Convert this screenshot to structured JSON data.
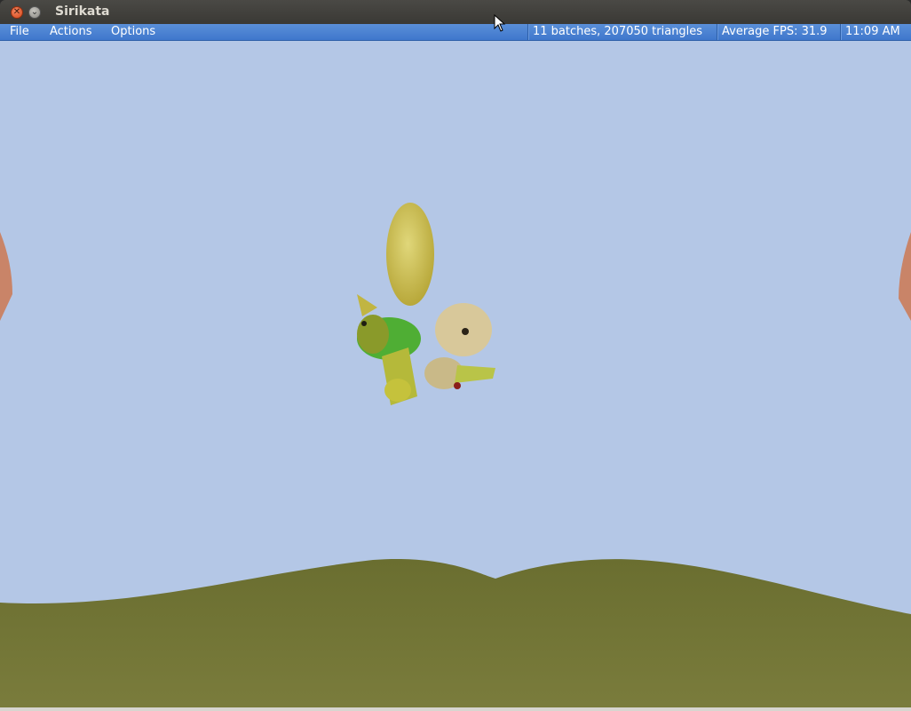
{
  "window": {
    "title": "Sirikata"
  },
  "menu": {
    "items": [
      "File",
      "Actions",
      "Options"
    ]
  },
  "status": {
    "batches": "11 batches, 207050 triangles",
    "fps": "Average FPS: 31.9",
    "clock": "11:09 AM"
  },
  "colors": {
    "sky": "#b4c7e6",
    "ground": "#6f7236",
    "menubar": "#4a82d4"
  },
  "icons": [
    "close-icon",
    "minimize-icon",
    "mouse-cursor-icon"
  ]
}
